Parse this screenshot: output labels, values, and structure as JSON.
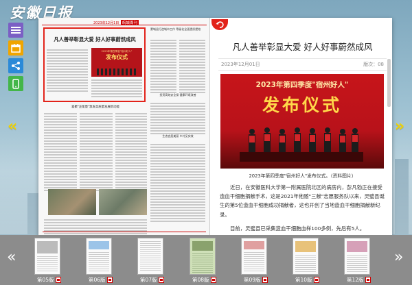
{
  "app": {
    "logo_text": "安徽日报"
  },
  "sidebar": {
    "buttons": [
      {
        "name": "menu-button",
        "icon": "menu-icon",
        "color": "#7b5fc4"
      },
      {
        "name": "calendar-button",
        "icon": "calendar-icon",
        "color": "#f0a500"
      },
      {
        "name": "share-button",
        "icon": "share-icon",
        "color": "#2b8ad8"
      },
      {
        "name": "mobile-button",
        "icon": "mobile-icon",
        "color": "#43b649"
      }
    ]
  },
  "nav": {
    "prev_symbol": "«",
    "next_symbol": "»"
  },
  "left_page": {
    "masthead": "2023年12月1日",
    "section": "皖城周刊",
    "highlight_headline": "凡人善举彰显大爱 好人好事蔚然成风",
    "photo_banner": "2023年第四季度\"宿州好人\"",
    "photo_title": "发布仪式",
    "sub_headline": "凝聚\"正能量\"激发高质量发展新动能",
    "right_col_heads": [
      "蒙城县打造城市工作 等级化全面提质提效",
      "投资高效安全保 健康环境改善",
      "生态宜居美丽 乡村见实效"
    ]
  },
  "article": {
    "title": "凡人善举彰显大爱 好人好事蔚然成风",
    "date": "2023年12月01日",
    "page": "版次：08",
    "photo_banner": "2023年第四季度\"宿州好人\"",
    "photo_title": "发布仪式",
    "caption": "2023年第四季度\"宿州好人\"发布仪式。（资料图片）",
    "paragraph1": "近日，在安徽医科大学第一附属医院北区的病房内，彭凡勃正在接受造血干细胞捐献手术，这是2021年他随\"三献\"志愿服务队以来，灵璧县诞生的第5位造血干细胞成功捐献者，这也开创了当地造血干细胞捐献新纪录。",
    "paragraph2": "目前，灵璧县已采集造血干细胞血样100多例，先后有5人。"
  },
  "thumbnails": [
    {
      "label": "第05版",
      "active": false
    },
    {
      "label": "第06版",
      "active": false
    },
    {
      "label": "第07版",
      "active": false
    },
    {
      "label": "第08版",
      "active": true
    },
    {
      "label": "第09版",
      "active": false
    },
    {
      "label": "第10版",
      "active": false
    },
    {
      "label": "第12版",
      "active": false
    }
  ],
  "colors": {
    "accent_red": "#e2231a",
    "arrow_yellow": "#f3d400",
    "strip_gray": "#8c8c8c"
  }
}
